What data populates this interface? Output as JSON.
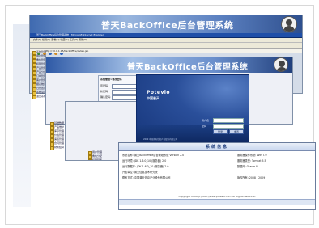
{
  "app": {
    "title": "普天BackOffice后台管理系统"
  },
  "browser": {
    "ie_title": "普天BackOffice后台管理系统 - Microsoft Internet Explorer",
    "menu": "文件(F)  编辑(E)  查看(V)  收藏(A)  工具(T)  帮助(H)",
    "address": "http://10.0.1.15/backoffice/index.jsp"
  },
  "tree_left": [
    "系统管理",
    "用户管理",
    "角色管理",
    "权限管理",
    "产品管理",
    "产品分类",
    "订单管理",
    "客户管理",
    "报表统计",
    "日志查询",
    "系统设置",
    "退出系统"
  ],
  "tree_mid": [
    "基础数据",
    "产品维护",
    "库存管理",
    "价格管理",
    "渠道管理",
    "合同管理",
    "财务结算"
  ],
  "tree_third": [
    "用户管理",
    "角色分配",
    "权限配置",
    "组织机构",
    "参数设置",
    "日志管理"
  ],
  "form": {
    "heading": "系统管理>修改密码",
    "label_old": "原密码:",
    "label_new": "新密码:",
    "label_confirm": "确认密码:"
  },
  "login": {
    "logo": "Potevio",
    "logo_sub": "中国普天",
    "user_label": "用户名",
    "password_label": "密码",
    "login_button": "登录",
    "reset_button": "重置",
    "copyright": "2009 中国普天信息产业股份有限公司"
  },
  "main": {
    "heading": "系统信息",
    "rows": [
      {
        "left": "系统名称: 普天BackOffice后台管理系统 Version 2.0",
        "right": "服务器操作系统: Win 7.0"
      },
      {
        "left": "运行环境: JDK 1.6.0_10 (服务器) 2.0",
        "right": "服务器类型: Tomcat 5.5"
      },
      {
        "left": "运行数据库: JDK 1.6.0_10 (服务器) 2.0",
        "right": "数据库: Oracle 9i"
      },
      {
        "left": "开发单位: 普天信息技术研究院",
        "right": ""
      },
      {
        "left": "联系方式: 中国普天信息产业股份有限公司",
        "right": "版权所有: 2008 - 2009"
      }
    ],
    "footer": "Copyright 2009 (c) http://www.potevio.com All Rights Reserved"
  }
}
